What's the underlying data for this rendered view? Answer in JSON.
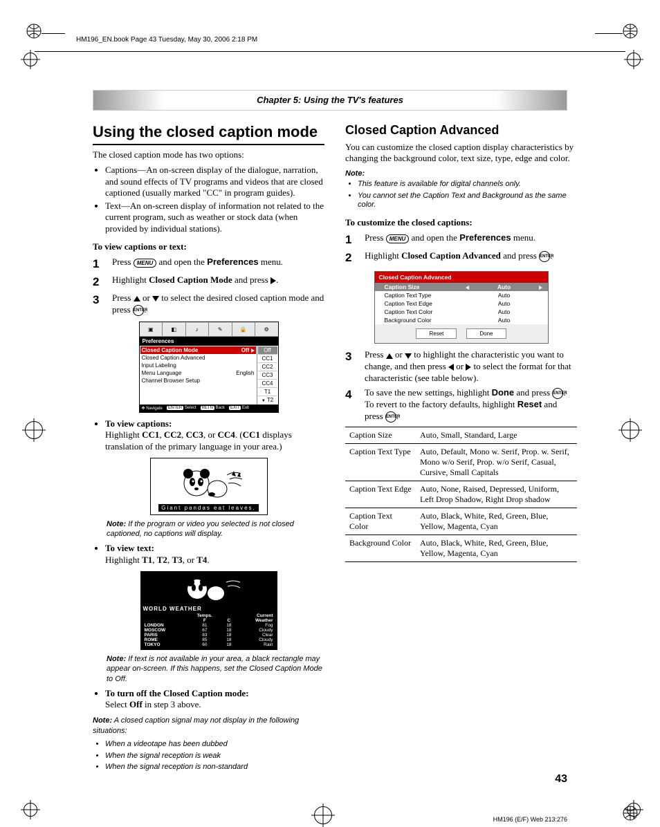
{
  "meta": {
    "header_text": "HM196_EN.book  Page 43  Tuesday, May 30, 2006  2:18 PM",
    "chapter": "Chapter 5: Using the TV's features",
    "page_number": "43",
    "footer": "HM196 (E/F) Web 213:276"
  },
  "left": {
    "h1": "Using the closed caption mode",
    "intro": "The closed caption mode has two options:",
    "options": [
      "Captions—An on-screen display of the dialogue, narration, and sound effects of TV programs and videos that are closed captioned (usually marked \"CC\" in program guides).",
      "Text—An on-screen display of information not related to the current program, such as weather or stock data (when provided by individual stations)."
    ],
    "sub1": "To view captions or text:",
    "steps": {
      "s1a": "Press ",
      "s1b": " and open the ",
      "s1c": " menu.",
      "pref": "Preferences",
      "s2a": "Highlight ",
      "s2b": " and press ",
      "mode": "Closed Caption Mode",
      "s3a": "Press ",
      "s3b": " or ",
      "s3c": " to select the desired closed caption mode and press "
    },
    "menu1": {
      "title": "Preferences",
      "rows": [
        {
          "l": "Closed Caption Mode",
          "r": "Off"
        },
        {
          "l": "Closed Caption Advanced",
          "r": ""
        },
        {
          "l": "Input Labeling",
          "r": ""
        },
        {
          "l": "Menu Language",
          "r": "English"
        },
        {
          "l": "Channel Browser Setup",
          "r": ""
        }
      ],
      "opts": [
        "Off",
        "CC1",
        "CC2",
        "CC3",
        "CC4",
        "T1",
        "T2"
      ],
      "nav": {
        "a": "Navigate",
        "b": "Select",
        "c": "Back",
        "d": "Exit",
        "kb": "ENTER",
        "kc": "RETN",
        "kd": "EXIT"
      }
    },
    "view_captions_label": "To view captions:",
    "view_captions_pre": "Highlight ",
    "cc_list": [
      "CC1",
      "CC2",
      "CC3",
      "CC4"
    ],
    "view_captions_post1": ". (",
    "view_captions_post2": " displays translation of the primary language in your area.)",
    "panda_caption": "Giant pandas eat leaves.",
    "note1": "If the program or video you selected is not closed captioned, no captions will display.",
    "view_text_label": "To view text:",
    "view_text_pre": "Highlight ",
    "t_list": [
      "T1",
      "T2",
      "T3",
      "T4"
    ],
    "weather": {
      "title": "WORLD WEATHER",
      "cols": [
        "",
        "Temps.",
        "",
        "Current"
      ],
      "sub": [
        "",
        "F",
        "C",
        "Weather"
      ],
      "rows": [
        [
          "LONDON",
          "81",
          "18",
          "Fog"
        ],
        [
          "MOSCOW",
          "67",
          "18",
          "Cloudy"
        ],
        [
          "PARIS",
          "83",
          "18",
          "Clear"
        ],
        [
          "ROME",
          "85",
          "18",
          "Cloudy"
        ],
        [
          "TOKYO",
          "60",
          "18",
          "Rain"
        ]
      ]
    },
    "note2": "If text is not available in your area, a black rectangle may appear on-screen. If this happens, set the Closed Caption Mode to Off.",
    "turnoff_label": "To turn off the Closed Caption mode:",
    "turnoff_a": "Select ",
    "turnoff_b": " in step 3 above.",
    "off": "Off",
    "note3_lead": "A closed caption signal may not display in the following situations:",
    "note3_items": [
      "When a videotape has been dubbed",
      "When the signal reception is weak",
      "When the signal reception is non-standard"
    ]
  },
  "right": {
    "h2": "Closed Caption Advanced",
    "intro": "You can customize the closed caption display characteristics by changing the background color, text size, type, edge and color.",
    "note_label": "Note:",
    "notes": [
      "This feature is available for digital channels only.",
      "You cannot set the Caption Text and Background as the same color."
    ],
    "sub": "To customize the closed captions:",
    "steps": {
      "s1a": "Press ",
      "s1b": " and open the ",
      "s1c": " menu.",
      "pref": "Preferences",
      "s2a": "Highlight ",
      "s2b": " and press ",
      "adv": "Closed Caption Advanced",
      "s3a": "Press ",
      "s3b": " or ",
      "s3c": " to highlight the characteristic you want to change, and then press ",
      "s3d": " or ",
      "s3e": " to select the format for that characteristic (see table below).",
      "s4a": "To save the new settings, highlight ",
      "s4b": " and press ",
      "s4c": ". To revert to the factory defaults, highlight ",
      "s4d": " and press ",
      "done": "Done",
      "reset": "Reset"
    },
    "menu2": {
      "title": "Closed Caption Advanced",
      "rows": [
        {
          "l": "Caption Size",
          "v": "Auto"
        },
        {
          "l": "Caption Text Type",
          "v": "Auto"
        },
        {
          "l": "Caption Text Edge",
          "v": "Auto"
        },
        {
          "l": "Caption Text Color",
          "v": "Auto"
        },
        {
          "l": "Background Color",
          "v": "Auto"
        }
      ],
      "reset": "Reset",
      "done": "Done"
    },
    "table": [
      {
        "k": "Caption Size",
        "v": "Auto, Small, Standard, Large"
      },
      {
        "k": "Caption Text Type",
        "v": "Auto, Default, Mono w. Serif, Prop. w. Serif, Mono w/o Serif, Prop. w/o Serif, Casual, Cursive, Small Capitals"
      },
      {
        "k": "Caption Text Edge",
        "v": "Auto, None, Raised, Depressed, Uniform, Left Drop Shadow, Right Drop shadow"
      },
      {
        "k": "Caption Text Color",
        "v": "Auto, Black, White, Red, Green, Blue, Yellow, Magenta, Cyan"
      },
      {
        "k": "Background Color",
        "v": "Auto, Black, White, Red, Green, Blue, Yellow, Magenta, Cyan"
      }
    ]
  },
  "labels": {
    "menu_btn": "MENU",
    "enter_btn": "ENTER",
    "note": "Note:"
  }
}
